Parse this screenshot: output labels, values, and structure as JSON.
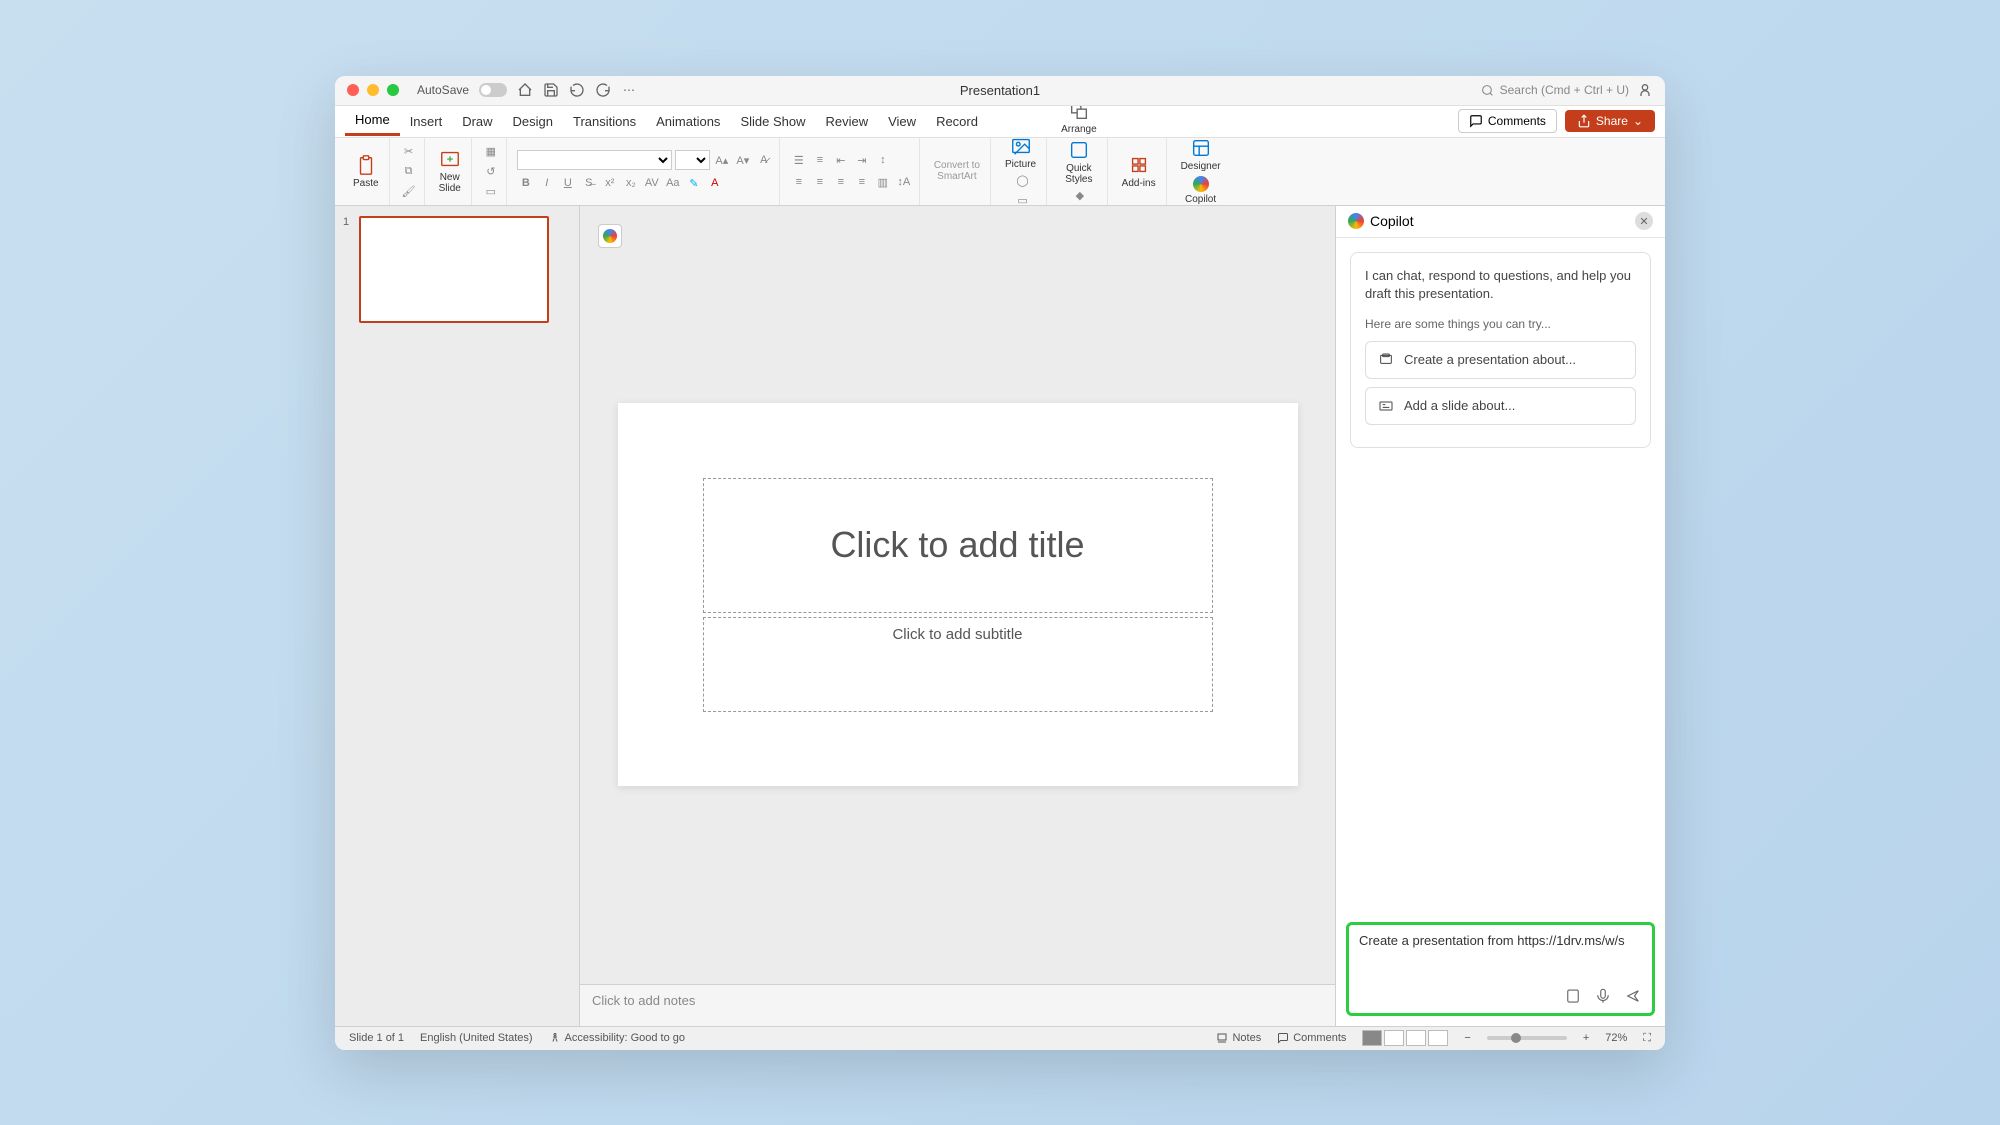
{
  "titlebar": {
    "autosave_label": "AutoSave",
    "document_title": "Presentation1",
    "search_placeholder": "Search (Cmd + Ctrl + U)"
  },
  "tabs": [
    "Home",
    "Insert",
    "Draw",
    "Design",
    "Transitions",
    "Animations",
    "Slide Show",
    "Review",
    "View",
    "Record"
  ],
  "active_tab": "Home",
  "tab_actions": {
    "comments": "Comments",
    "share": "Share"
  },
  "ribbon": {
    "paste": "Paste",
    "new_slide": "New\nSlide",
    "convert": "Convert to\nSmartArt",
    "picture": "Picture",
    "arrange": "Arrange",
    "quick_styles": "Quick\nStyles",
    "addins": "Add-ins",
    "designer": "Designer",
    "copilot": "Copilot"
  },
  "thumb": {
    "number": "1"
  },
  "slide": {
    "title_placeholder": "Click to add title",
    "subtitle_placeholder": "Click to add subtitle"
  },
  "notes_placeholder": "Click to add notes",
  "copilot": {
    "title": "Copilot",
    "intro": "I can chat, respond to questions, and help you draft this presentation.",
    "hint": "Here are some things you can try...",
    "suggestions": [
      "Create a presentation about...",
      "Add a slide about..."
    ],
    "input_value": "Create a presentation from https://1drv.ms/w/s"
  },
  "statusbar": {
    "slide_info": "Slide 1 of 1",
    "language": "English (United States)",
    "accessibility": "Accessibility: Good to go",
    "notes": "Notes",
    "comments": "Comments",
    "zoom": "72%"
  }
}
